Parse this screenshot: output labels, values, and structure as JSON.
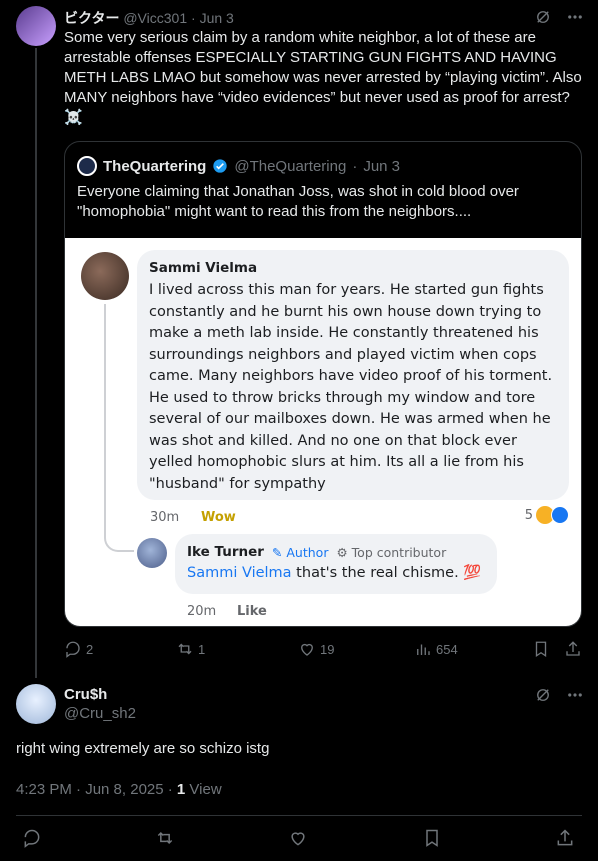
{
  "tweet1": {
    "author_name": "ビクター",
    "author_handle": "@Vicc301",
    "separator": "·",
    "date": "Jun 3",
    "text": "Some very serious claim by a random white neighbor, a lot of these are arrestable offenses ESPECIALLY STARTING GUN FIGHTS AND HAVING METH LABS LMAO but somehow was never arrested by “playing victim”. Also MANY neighbors have “video evidences” but never used as proof for arrest?☠️",
    "quote": {
      "author_name": "TheQuartering",
      "author_handle": "@TheQuartering",
      "separator": "·",
      "date": "Jun 3",
      "text": "Everyone claiming that Jonathan Joss, was shot in cold blood over \"homophobia\" might want to read this from the neighbors....",
      "embedded_image": {
        "comment1": {
          "name": "Sammi Vielma",
          "text": "I lived across this man for years. He started gun fights constantly and he burnt his own house down trying to make a meth lab inside. He constantly threatened his surroundings neighbors and played victim when cops came. Many neighbors have video proof of his torment. He used to throw bricks through my window and tore several of our mailboxes down. He was armed when he was shot and killed. And no one on that block ever yelled homophobic slurs at him. Its all a lie from his \"husband\" for sympathy",
          "time": "30m",
          "reaction_label": "Wow",
          "reaction_count": "5"
        },
        "comment2": {
          "name": "Ike Turner",
          "author_badge": "Author",
          "contributor_badge": "Top contributor",
          "mention": "Sammi Vielma",
          "text": " that's the real chisme. 💯",
          "time": "20m",
          "like_label": "Like"
        }
      }
    },
    "actions": {
      "replies": "2",
      "retweets": "1",
      "likes": "19",
      "views": "654"
    }
  },
  "tweet2": {
    "author_name": "Cru$h",
    "author_handle": "@Cru_sh2",
    "text": "right wing extremely are so schizo istg",
    "time": "4:23 PM · Jun 8, 2025 · ",
    "views_count": "1",
    "views_label": " View"
  },
  "colors": {
    "background": "#000000",
    "text": "#e7e9ea",
    "muted": "#71767b",
    "border": "#2f3336",
    "verified": "#1d9bf0",
    "facebook_blue": "#1877f2"
  },
  "icons": [
    "grok-icon",
    "more-icon",
    "verified-badge-icon",
    "reply-icon",
    "retweet-icon",
    "like-icon",
    "views-icon",
    "bookmark-icon",
    "share-icon",
    "wow-emoji-icon",
    "like-emoji-icon"
  ]
}
